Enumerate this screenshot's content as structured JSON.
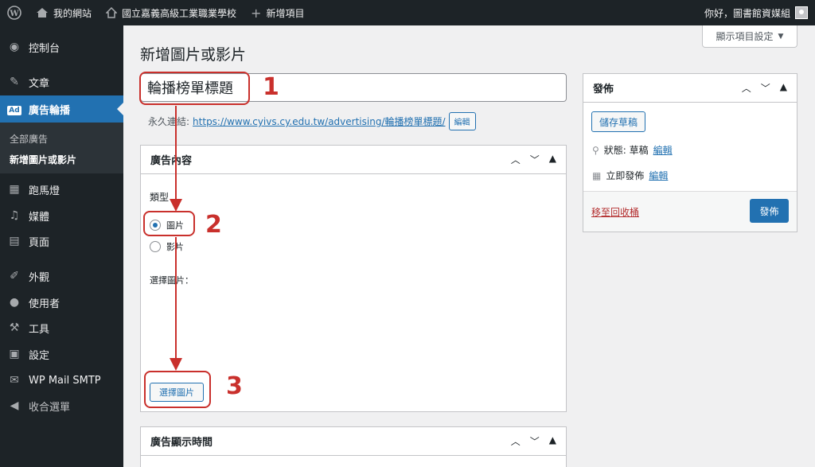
{
  "adminbar": {
    "site_name": "我的網站",
    "school_name": "國立嘉義高級工業職業學校",
    "new_item": "新增項目",
    "greeting": "你好，圖書館資媒組"
  },
  "sidebar": {
    "items": [
      {
        "label": "控制台",
        "icon": "dashboard-icon"
      },
      {
        "label": "文章",
        "icon": "pin-icon"
      },
      {
        "label": "廣告輪播",
        "icon": "ad-icon"
      },
      {
        "label": "跑馬燈",
        "icon": "marquee-icon"
      },
      {
        "label": "媒體",
        "icon": "media-icon"
      },
      {
        "label": "頁面",
        "icon": "page-icon"
      },
      {
        "label": "外觀",
        "icon": "brush-icon"
      },
      {
        "label": "使用者",
        "icon": "user-icon"
      },
      {
        "label": "工具",
        "icon": "wrench-icon"
      },
      {
        "label": "設定",
        "icon": "settings-icon"
      },
      {
        "label": "WP Mail SMTP",
        "icon": "mail-icon"
      },
      {
        "label": "收合選單",
        "icon": "collapse-icon"
      }
    ],
    "ad_badge": "Ad",
    "submenu": [
      "全部廣告",
      "新增圖片或影片"
    ]
  },
  "screen_options": "顯示項目設定",
  "page_title": "新增圖片或影片",
  "title_value": "輪播榜單標題",
  "permalink": {
    "label": "永久連結:",
    "url": "https://www.cyivs.cy.edu.tw/advertising/輪播榜單標題/",
    "edit_button": "編輯"
  },
  "ad_content_box": {
    "title": "廣告內容",
    "type_label": "類型",
    "options": [
      {
        "label": "圖片",
        "selected": true
      },
      {
        "label": "影片",
        "selected": false
      }
    ],
    "choose_label": "選擇圖片：",
    "choose_button": "選擇圖片"
  },
  "ad_time_box": {
    "title": "廣告顯示時間"
  },
  "publish_box": {
    "title": "發佈",
    "save_draft": "儲存草稿",
    "status_label": "狀態: 草稿",
    "status_edit": "編輯",
    "schedule_label": "立即發佈",
    "schedule_edit": "編輯",
    "trash": "移至回收桶",
    "publish_button": "發佈"
  },
  "annotations": [
    "1",
    "2",
    "3"
  ],
  "colors": {
    "accent": "#2271b1",
    "annotation": "#c9302c",
    "adminbar": "#1d2327"
  }
}
